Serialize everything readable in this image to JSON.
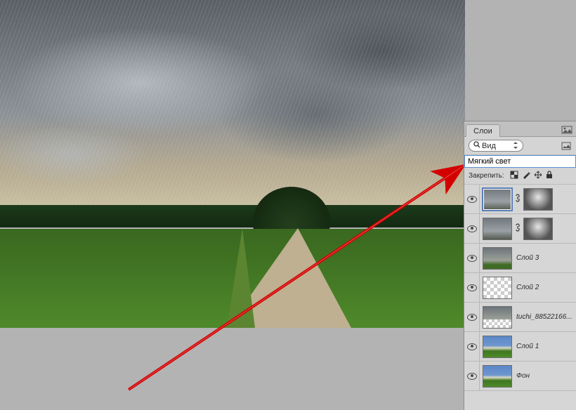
{
  "panel": {
    "tab_label": "Слои",
    "filter_label": "Вид",
    "blend_mode": "Мягкий свет",
    "lock_label": "Закрепить:"
  },
  "layers": [
    {
      "name": "",
      "has_mask": true,
      "selected": true,
      "type": "rain"
    },
    {
      "name": "",
      "has_mask": true,
      "selected": false,
      "type": "rain"
    },
    {
      "name": "Слой 3",
      "has_mask": false,
      "selected": false,
      "type": "sky"
    },
    {
      "name": "Слой 2",
      "has_mask": false,
      "selected": false,
      "type": "checker"
    },
    {
      "name": "tuchi_88522166...",
      "has_mask": false,
      "selected": false,
      "type": "sky-half"
    },
    {
      "name": "Слой 1",
      "has_mask": false,
      "selected": false,
      "type": "photo"
    },
    {
      "name": "Фон",
      "has_mask": false,
      "selected": false,
      "type": "photo"
    }
  ]
}
